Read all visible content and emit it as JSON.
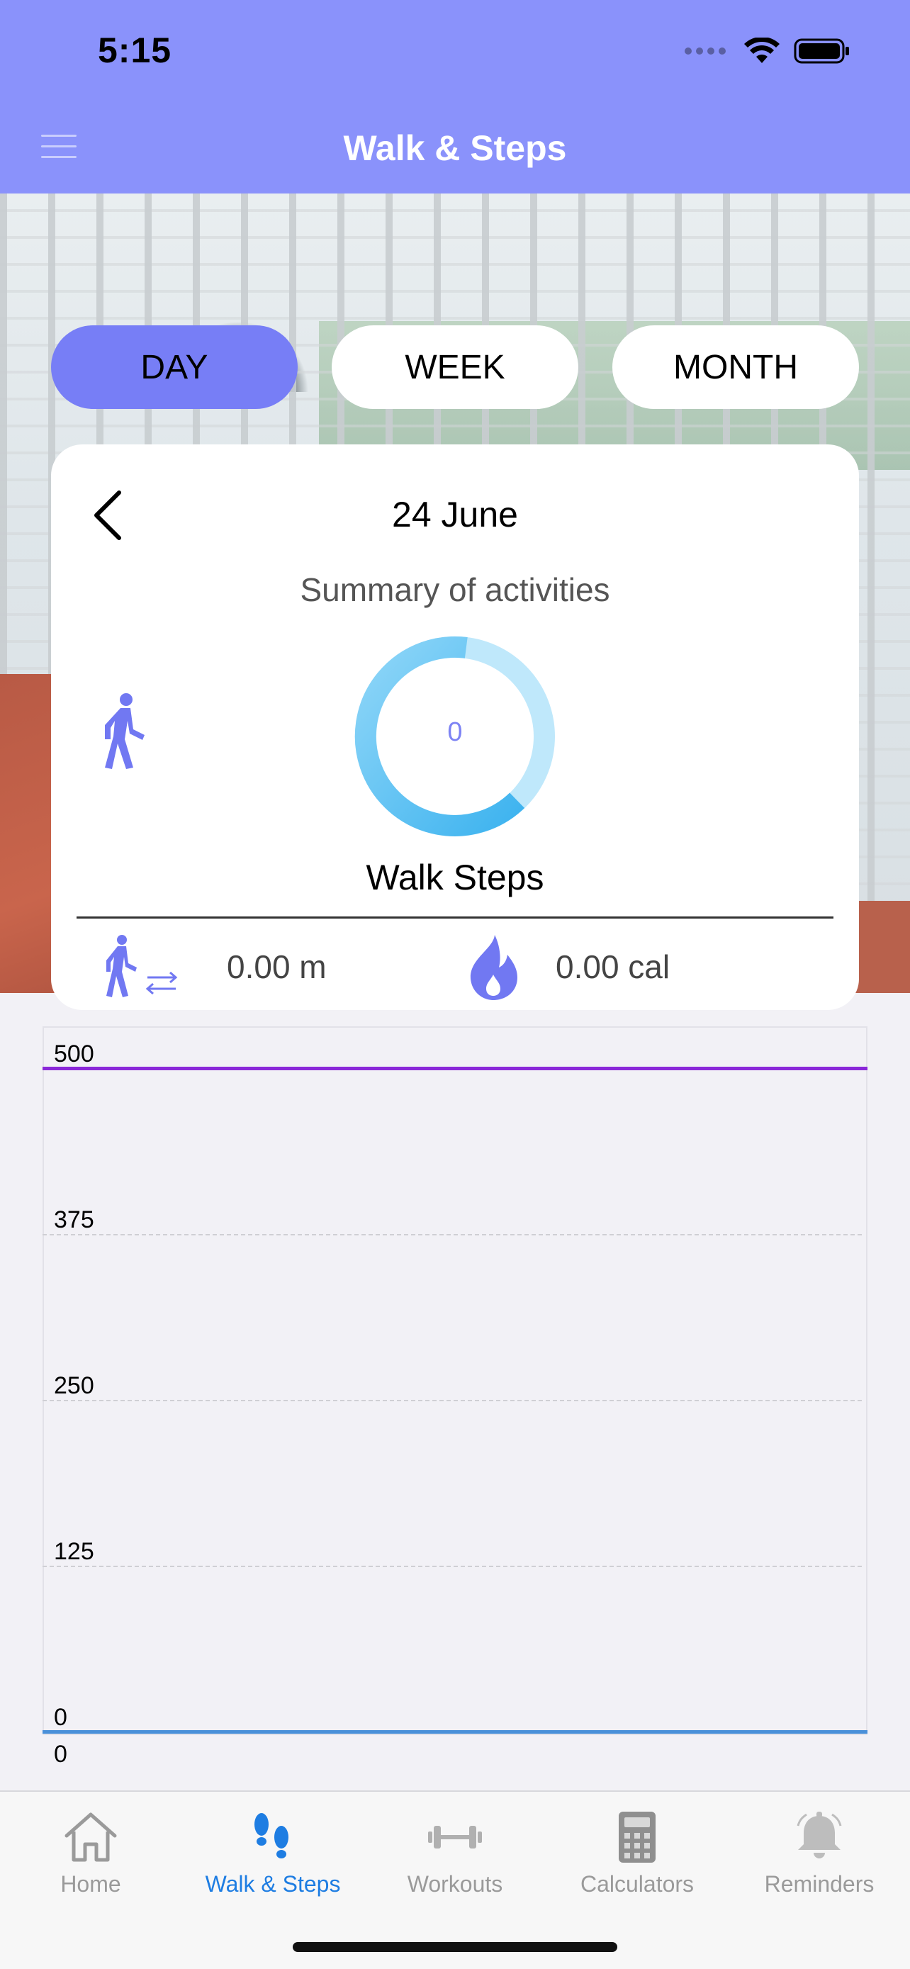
{
  "status_bar": {
    "time": "5:15"
  },
  "nav": {
    "title": "Walk & Steps",
    "menu_icon": "hamburger-icon"
  },
  "periods": [
    {
      "label": "DAY",
      "selected": true
    },
    {
      "label": "WEEK",
      "selected": false
    },
    {
      "label": "MONTH",
      "selected": false
    }
  ],
  "summary": {
    "date": "24 June",
    "subtitle": "Summary of activities",
    "steps_value": "0",
    "steps_label": "Walk Steps",
    "distance": "0.00 m",
    "calories": "0.00 cal"
  },
  "chart_data": {
    "type": "line",
    "y_ticks": [
      "500",
      "375",
      "250",
      "125",
      "0"
    ],
    "ylim": [
      0,
      500
    ],
    "limit_line_value": 500,
    "x_labels": [
      "0"
    ],
    "values": [],
    "grid": true
  },
  "tabs": [
    {
      "label": "Home",
      "icon": "home-icon",
      "active": false
    },
    {
      "label": "Walk & Steps",
      "icon": "footsteps-icon",
      "active": true
    },
    {
      "label": "Workouts",
      "icon": "dumbbell-icon",
      "active": false
    },
    {
      "label": "Calculators",
      "icon": "calculator-icon",
      "active": false
    },
    {
      "label": "Reminders",
      "icon": "bell-icon",
      "active": false
    }
  ],
  "colors": {
    "nav_bar": "#8a92fb",
    "accent": "#777ef6",
    "ring": "#5bc4f4",
    "ring_track": "#bfe8fb",
    "limit_line": "#8a27d8",
    "tab_active": "#1e7de2"
  }
}
